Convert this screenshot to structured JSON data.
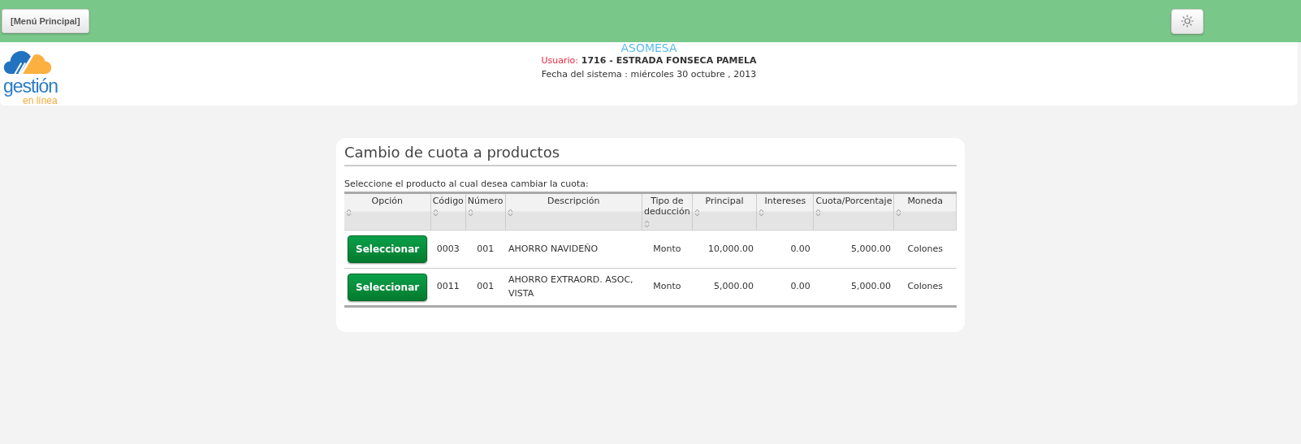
{
  "top_bar": {
    "menu_button": "[Menú Principal]"
  },
  "logo": {
    "word": "gestión",
    "tagline": "en línea"
  },
  "header": {
    "organization": "ASOMESA",
    "user_label": "Usuario:",
    "user_value": "1716 - ESTRADA FONSECA PAMELA",
    "date_line": "Fecha del sistema : miércoles 30 octubre , 2013"
  },
  "panel": {
    "title": "Cambio de cuota a productos",
    "instruction": "Seleccione el producto al cual desea cambiar la cuota:",
    "table": {
      "columns": [
        {
          "label": "Opción"
        },
        {
          "label": "Código"
        },
        {
          "label": "Número"
        },
        {
          "label": "Descripción"
        },
        {
          "label": "Tipo de deducción"
        },
        {
          "label": "Principal"
        },
        {
          "label": "Intereses"
        },
        {
          "label": "Cuota/Porcentaje"
        },
        {
          "label": "Moneda"
        }
      ],
      "rows": [
        {
          "cells": [
            "Seleccionar",
            "0003",
            "001",
            "AHORRO NAVIDEÑO",
            "Monto",
            "10,000.00",
            "0.00",
            "5,000.00",
            "Colones"
          ]
        },
        {
          "cells": [
            "Seleccionar",
            "0011",
            "001",
            "AHORRO EXTRAORD. ASOC, VISTA",
            "Monto",
            "5,000.00",
            "0.00",
            "5,000.00",
            "Colones"
          ]
        }
      ]
    }
  }
}
